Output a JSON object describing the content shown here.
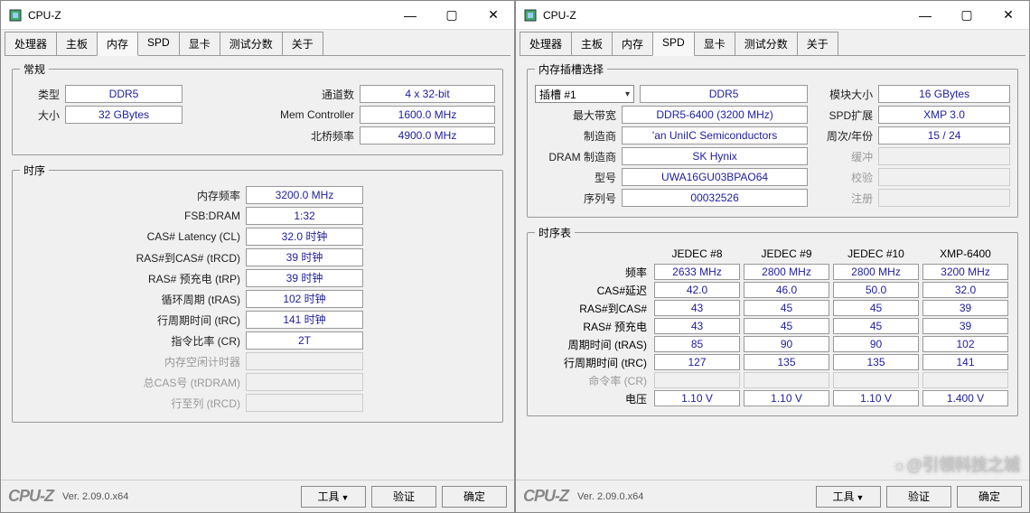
{
  "app": {
    "title": "CPU-Z"
  },
  "winbtns": {
    "min": "—",
    "max": "▢",
    "close": "✕"
  },
  "tabs": [
    "处理器",
    "主板",
    "内存",
    "SPD",
    "显卡",
    "测试分数",
    "关于"
  ],
  "win1": {
    "activeTab": "内存",
    "general": {
      "legend": "常规",
      "type_lbl": "类型",
      "type_val": "DDR5",
      "size_lbl": "大小",
      "size_val": "32 GBytes",
      "channels_lbl": "通道数",
      "channels_val": "4 x 32-bit",
      "memctrl_lbl": "Mem Controller",
      "memctrl_val": "1600.0 MHz",
      "nb_lbl": "北桥频率",
      "nb_val": "4900.0 MHz"
    },
    "timing": {
      "legend": "时序",
      "freq_lbl": "内存频率",
      "freq_val": "3200.0 MHz",
      "fsbdram_lbl": "FSB:DRAM",
      "fsbdram_val": "1:32",
      "cl_lbl": "CAS# Latency (CL)",
      "cl_val": "32.0 时钟",
      "trcd_lbl": "RAS#到CAS# (tRCD)",
      "trcd_val": "39 时钟",
      "trp_lbl": "RAS# 预充电 (tRP)",
      "trp_val": "39 时钟",
      "tras_lbl": "循环周期 (tRAS)",
      "tras_val": "102 时钟",
      "trc_lbl": "行周期时间 (tRC)",
      "trc_val": "141 时钟",
      "cr_lbl": "指令比率 (CR)",
      "cr_val": "2T",
      "idle_lbl": "内存空闲计时器",
      "tcas_lbl": "总CAS号 (tRDRAM)",
      "rowcol_lbl": "行至列 (tRCD)"
    }
  },
  "win2": {
    "activeTab": "SPD",
    "slot": {
      "legend": "内存插槽选择",
      "slot_lbl": "插槽 #1",
      "type_val": "DDR5",
      "maxbw_lbl": "最大带宽",
      "maxbw_val": "DDR5-6400 (3200 MHz)",
      "mfr_lbl": "制造商",
      "mfr_val": "'an UniIC Semiconductors",
      "drammfr_lbl": "DRAM 制造商",
      "drammfr_val": "SK Hynix",
      "pn_lbl": "型号",
      "pn_val": "UWA16GU03BPAO64",
      "sn_lbl": "序列号",
      "sn_val": "00032526",
      "modsize_lbl": "模块大小",
      "modsize_val": "16 GBytes",
      "spdext_lbl": "SPD扩展",
      "spdext_val": "XMP 3.0",
      "week_lbl": "周次/年份",
      "week_val": "15 / 24",
      "buf_lbl": "缓冲",
      "ecc_lbl": "校验",
      "reg_lbl": "注册"
    },
    "ttable": {
      "legend": "时序表",
      "cols": [
        "JEDEC #8",
        "JEDEC #9",
        "JEDEC #10",
        "XMP-6400"
      ],
      "freq_lbl": "频率",
      "freq": [
        "2633 MHz",
        "2800 MHz",
        "2800 MHz",
        "3200 MHz"
      ],
      "cas_lbl": "CAS#延迟",
      "cas": [
        "42.0",
        "46.0",
        "50.0",
        "32.0"
      ],
      "trcd_lbl": "RAS#到CAS#",
      "trcd": [
        "43",
        "45",
        "45",
        "39"
      ],
      "trp_lbl": "RAS# 预充电",
      "trp": [
        "43",
        "45",
        "45",
        "39"
      ],
      "tras_lbl": "周期时间 (tRAS)",
      "tras": [
        "85",
        "90",
        "90",
        "102"
      ],
      "trc_lbl": "行周期时间 (tRC)",
      "trc": [
        "127",
        "135",
        "135",
        "141"
      ],
      "cr_lbl": "命令率 (CR)",
      "volt_lbl": "电压",
      "volt": [
        "1.10 V",
        "1.10 V",
        "1.10 V",
        "1.400 V"
      ]
    }
  },
  "footer": {
    "logo": "CPU-Z",
    "ver": "Ver. 2.09.0.x64",
    "tools": "工具",
    "validate": "验证",
    "ok": "确定"
  },
  "watermark": "☼@引领科技之城"
}
